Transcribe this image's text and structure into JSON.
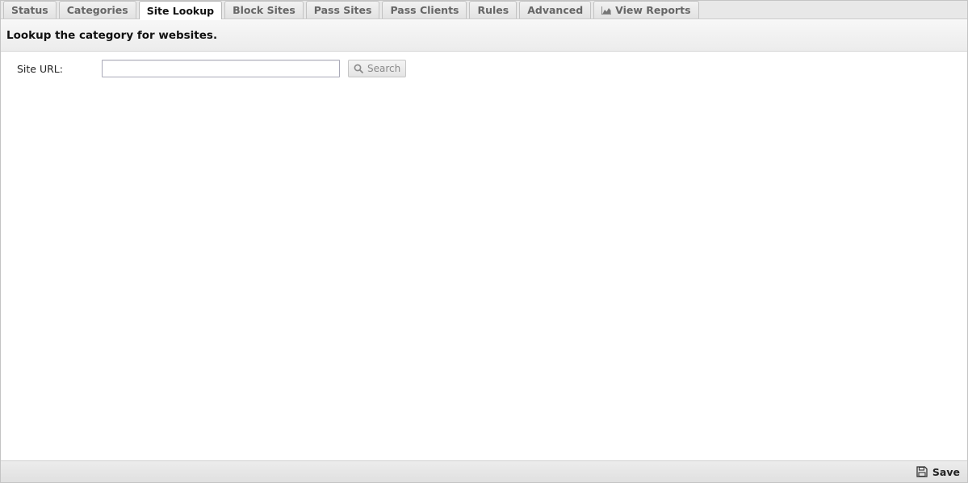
{
  "tabs": [
    {
      "label": "Status",
      "active": false
    },
    {
      "label": "Categories",
      "active": false
    },
    {
      "label": "Site Lookup",
      "active": true
    },
    {
      "label": "Block Sites",
      "active": false
    },
    {
      "label": "Pass Sites",
      "active": false
    },
    {
      "label": "Pass Clients",
      "active": false
    },
    {
      "label": "Rules",
      "active": false
    },
    {
      "label": "Advanced",
      "active": false
    },
    {
      "label": "View Reports",
      "active": false,
      "icon": "chart-icon"
    }
  ],
  "heading": "Lookup the category for websites.",
  "form": {
    "site_url_label": "Site URL:",
    "site_url_value": "",
    "search_label": "Search",
    "search_icon": "search-icon"
  },
  "footer": {
    "save_label": "Save",
    "save_icon": "floppy-disk-icon"
  },
  "colors": {
    "tab_bar": "#e8e8e8",
    "active_tab": "#ffffff",
    "tab_text": "#666666",
    "heading_band": "#f0f0f0",
    "footer": "#e6e6e6"
  }
}
